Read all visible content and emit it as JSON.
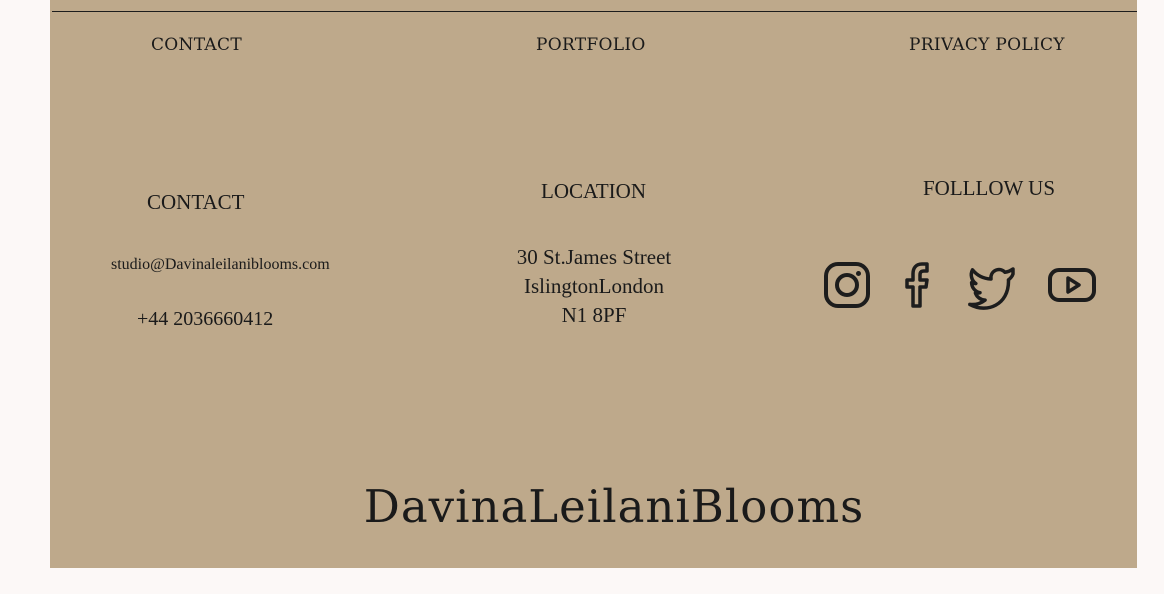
{
  "nav": {
    "contact": "CONTACT",
    "portfolio": "PORTFOLIO",
    "privacy": "PRIVACY POLICY"
  },
  "contact": {
    "heading": "CONTACT",
    "email": "studio@Davinaleilaniblooms.com",
    "phone": "+44 2036660412"
  },
  "location": {
    "heading": "LOCATION",
    "line1": "30 St.James Street",
    "line2": "IslingtonLondon",
    "line3": "N1 8PF"
  },
  "follow": {
    "heading": "FOLLLOW US",
    "icons": [
      "instagram-icon",
      "facebook-icon",
      "twitter-icon",
      "youtube-icon"
    ]
  },
  "brand": "DavinaLeilaniBlooms",
  "colors": {
    "footer_bg": "#bea98b",
    "page_bg": "#fcf8f7",
    "text": "#1a1a1a"
  }
}
